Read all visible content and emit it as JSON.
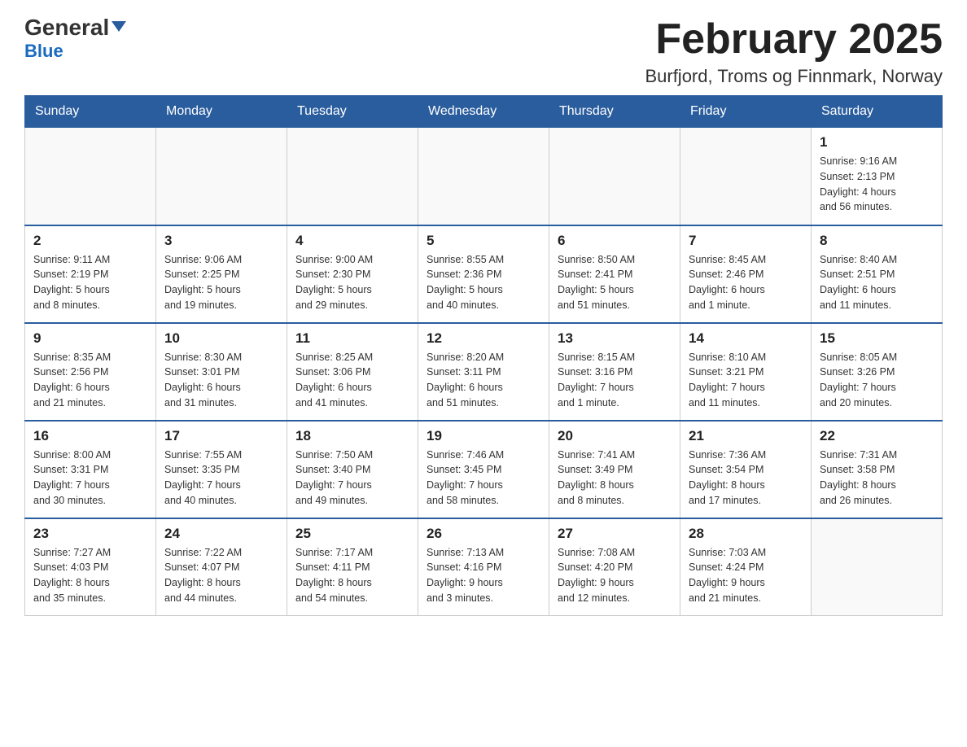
{
  "header": {
    "logo_main": "General",
    "logo_sub": "Blue",
    "month_title": "February 2025",
    "location": "Burfjord, Troms og Finnmark, Norway"
  },
  "weekdays": [
    "Sunday",
    "Monday",
    "Tuesday",
    "Wednesday",
    "Thursday",
    "Friday",
    "Saturday"
  ],
  "weeks": [
    [
      {
        "day": "",
        "info": ""
      },
      {
        "day": "",
        "info": ""
      },
      {
        "day": "",
        "info": ""
      },
      {
        "day": "",
        "info": ""
      },
      {
        "day": "",
        "info": ""
      },
      {
        "day": "",
        "info": ""
      },
      {
        "day": "1",
        "info": "Sunrise: 9:16 AM\nSunset: 2:13 PM\nDaylight: 4 hours\nand 56 minutes."
      }
    ],
    [
      {
        "day": "2",
        "info": "Sunrise: 9:11 AM\nSunset: 2:19 PM\nDaylight: 5 hours\nand 8 minutes."
      },
      {
        "day": "3",
        "info": "Sunrise: 9:06 AM\nSunset: 2:25 PM\nDaylight: 5 hours\nand 19 minutes."
      },
      {
        "day": "4",
        "info": "Sunrise: 9:00 AM\nSunset: 2:30 PM\nDaylight: 5 hours\nand 29 minutes."
      },
      {
        "day": "5",
        "info": "Sunrise: 8:55 AM\nSunset: 2:36 PM\nDaylight: 5 hours\nand 40 minutes."
      },
      {
        "day": "6",
        "info": "Sunrise: 8:50 AM\nSunset: 2:41 PM\nDaylight: 5 hours\nand 51 minutes."
      },
      {
        "day": "7",
        "info": "Sunrise: 8:45 AM\nSunset: 2:46 PM\nDaylight: 6 hours\nand 1 minute."
      },
      {
        "day": "8",
        "info": "Sunrise: 8:40 AM\nSunset: 2:51 PM\nDaylight: 6 hours\nand 11 minutes."
      }
    ],
    [
      {
        "day": "9",
        "info": "Sunrise: 8:35 AM\nSunset: 2:56 PM\nDaylight: 6 hours\nand 21 minutes."
      },
      {
        "day": "10",
        "info": "Sunrise: 8:30 AM\nSunset: 3:01 PM\nDaylight: 6 hours\nand 31 minutes."
      },
      {
        "day": "11",
        "info": "Sunrise: 8:25 AM\nSunset: 3:06 PM\nDaylight: 6 hours\nand 41 minutes."
      },
      {
        "day": "12",
        "info": "Sunrise: 8:20 AM\nSunset: 3:11 PM\nDaylight: 6 hours\nand 51 minutes."
      },
      {
        "day": "13",
        "info": "Sunrise: 8:15 AM\nSunset: 3:16 PM\nDaylight: 7 hours\nand 1 minute."
      },
      {
        "day": "14",
        "info": "Sunrise: 8:10 AM\nSunset: 3:21 PM\nDaylight: 7 hours\nand 11 minutes."
      },
      {
        "day": "15",
        "info": "Sunrise: 8:05 AM\nSunset: 3:26 PM\nDaylight: 7 hours\nand 20 minutes."
      }
    ],
    [
      {
        "day": "16",
        "info": "Sunrise: 8:00 AM\nSunset: 3:31 PM\nDaylight: 7 hours\nand 30 minutes."
      },
      {
        "day": "17",
        "info": "Sunrise: 7:55 AM\nSunset: 3:35 PM\nDaylight: 7 hours\nand 40 minutes."
      },
      {
        "day": "18",
        "info": "Sunrise: 7:50 AM\nSunset: 3:40 PM\nDaylight: 7 hours\nand 49 minutes."
      },
      {
        "day": "19",
        "info": "Sunrise: 7:46 AM\nSunset: 3:45 PM\nDaylight: 7 hours\nand 58 minutes."
      },
      {
        "day": "20",
        "info": "Sunrise: 7:41 AM\nSunset: 3:49 PM\nDaylight: 8 hours\nand 8 minutes."
      },
      {
        "day": "21",
        "info": "Sunrise: 7:36 AM\nSunset: 3:54 PM\nDaylight: 8 hours\nand 17 minutes."
      },
      {
        "day": "22",
        "info": "Sunrise: 7:31 AM\nSunset: 3:58 PM\nDaylight: 8 hours\nand 26 minutes."
      }
    ],
    [
      {
        "day": "23",
        "info": "Sunrise: 7:27 AM\nSunset: 4:03 PM\nDaylight: 8 hours\nand 35 minutes."
      },
      {
        "day": "24",
        "info": "Sunrise: 7:22 AM\nSunset: 4:07 PM\nDaylight: 8 hours\nand 44 minutes."
      },
      {
        "day": "25",
        "info": "Sunrise: 7:17 AM\nSunset: 4:11 PM\nDaylight: 8 hours\nand 54 minutes."
      },
      {
        "day": "26",
        "info": "Sunrise: 7:13 AM\nSunset: 4:16 PM\nDaylight: 9 hours\nand 3 minutes."
      },
      {
        "day": "27",
        "info": "Sunrise: 7:08 AM\nSunset: 4:20 PM\nDaylight: 9 hours\nand 12 minutes."
      },
      {
        "day": "28",
        "info": "Sunrise: 7:03 AM\nSunset: 4:24 PM\nDaylight: 9 hours\nand 21 minutes."
      },
      {
        "day": "",
        "info": ""
      }
    ]
  ]
}
